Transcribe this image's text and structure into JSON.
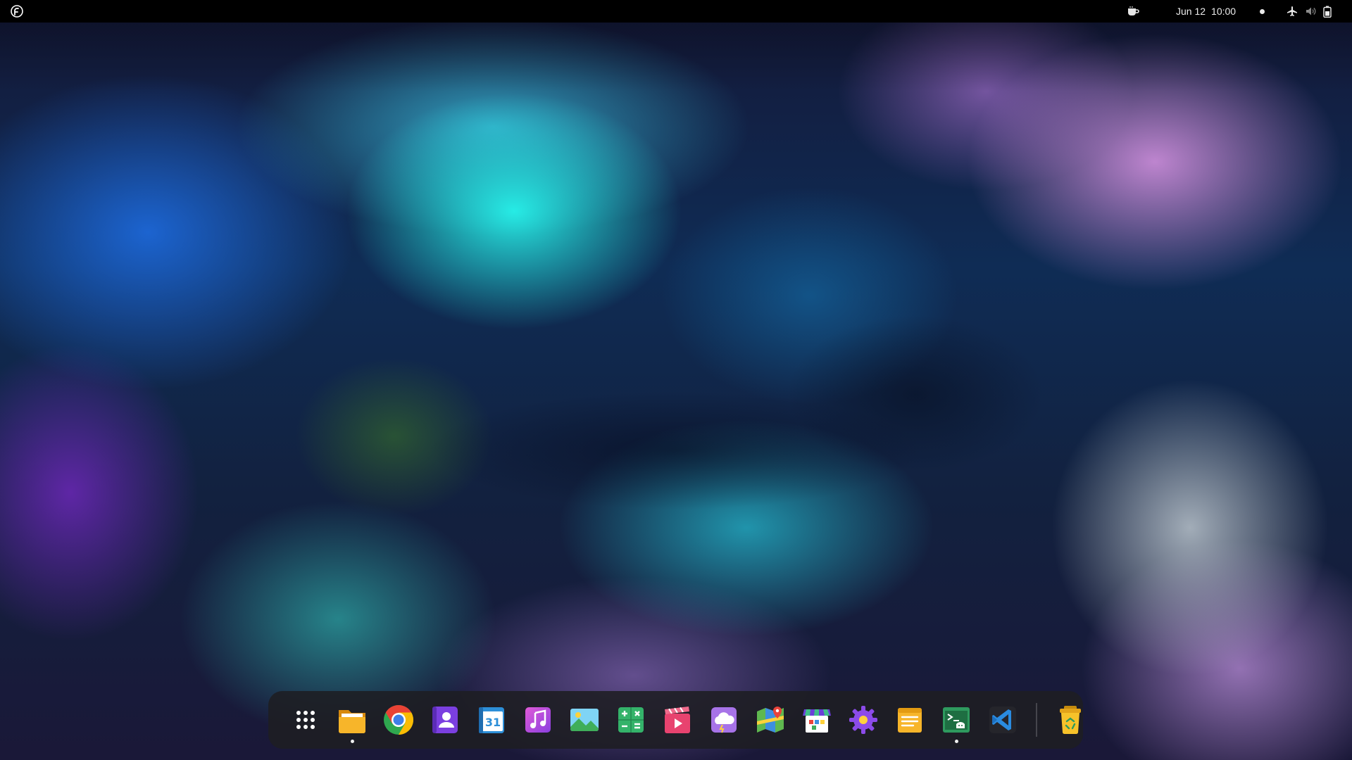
{
  "top_panel": {
    "activities_icon": "fedora-logo-icon",
    "date": "Jun 12",
    "time": "10:00",
    "status_icons": [
      "coffee-icon",
      "notification-dot",
      "airplane-mode-icon",
      "volume-muted-icon",
      "battery-icon"
    ]
  },
  "dock": {
    "items": [
      {
        "name": "show-apps",
        "icon": "app-grid-icon",
        "running": false
      },
      {
        "name": "files",
        "icon": "folder-icon",
        "running": true
      },
      {
        "name": "chrome",
        "icon": "chrome-icon",
        "running": false
      },
      {
        "name": "contacts",
        "icon": "contacts-icon",
        "running": false
      },
      {
        "name": "calendar",
        "icon": "calendar-icon",
        "running": false
      },
      {
        "name": "music",
        "icon": "music-icon",
        "running": false
      },
      {
        "name": "photos",
        "icon": "photos-icon",
        "running": false
      },
      {
        "name": "calculator",
        "icon": "calculator-icon",
        "running": false
      },
      {
        "name": "videos",
        "icon": "video-player-icon",
        "running": false
      },
      {
        "name": "weather",
        "icon": "weather-icon",
        "running": false
      },
      {
        "name": "maps",
        "icon": "maps-icon",
        "running": false
      },
      {
        "name": "software",
        "icon": "software-store-icon",
        "running": false
      },
      {
        "name": "settings",
        "icon": "settings-gear-icon",
        "running": false
      },
      {
        "name": "text-editor",
        "icon": "text-editor-icon",
        "running": false
      },
      {
        "name": "terminal",
        "icon": "terminal-icon",
        "running": true
      },
      {
        "name": "vscode",
        "icon": "vscode-icon",
        "running": false
      }
    ],
    "trash": {
      "name": "trash",
      "icon": "trash-icon",
      "running": false
    }
  },
  "colors": {
    "panel_bg": "#000000",
    "dock_bg": "#1e1e22",
    "folder_yellow": "#f5b01e",
    "purple_accent": "#8c4bea",
    "green_accent": "#2fb571"
  }
}
